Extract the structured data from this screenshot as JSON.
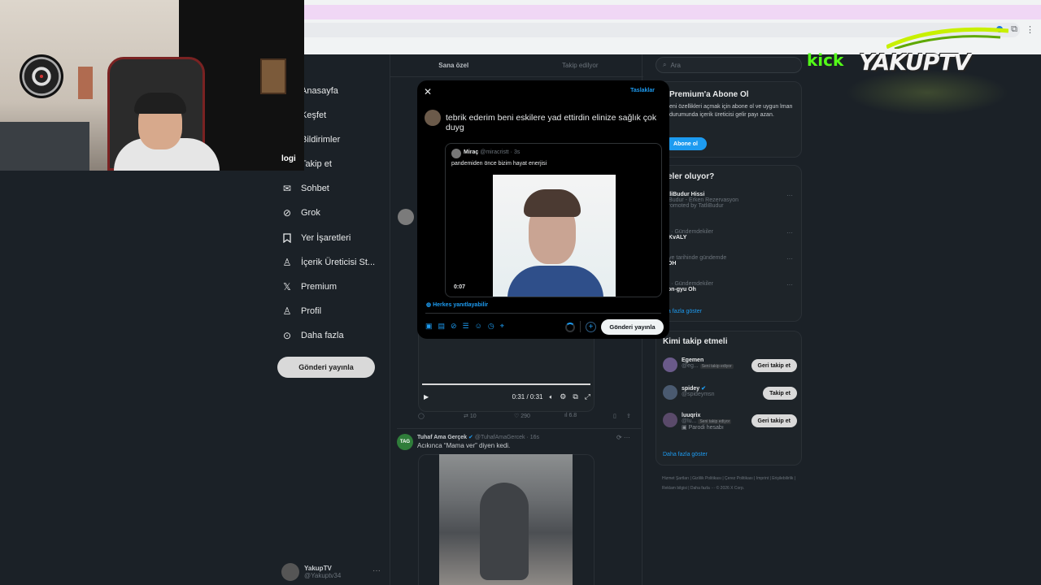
{
  "browser": {
    "title": ""
  },
  "webcam": {
    "brand_label": "logi"
  },
  "sidebar": {
    "items": [
      {
        "label": "Anasayfa",
        "icon": "home-icon"
      },
      {
        "label": "Keşfet",
        "icon": "search-icon"
      },
      {
        "label": "Bildirimler",
        "icon": "bell-icon"
      },
      {
        "label": "Takip et",
        "icon": "people-icon"
      },
      {
        "label": "Sohbet",
        "icon": "mail-icon"
      },
      {
        "label": "Grok",
        "icon": "grok-icon"
      },
      {
        "label": "Yer İşaretleri",
        "icon": "bookmark-icon"
      },
      {
        "label": "İçerik Üreticisi St...",
        "icon": "creator-icon"
      },
      {
        "label": "Premium",
        "icon": "x-logo-icon"
      },
      {
        "label": "Profil",
        "icon": "person-icon"
      },
      {
        "label": "Daha fazla",
        "icon": "more-circle-icon"
      }
    ],
    "post_button": "Gönderi yayınla",
    "account": {
      "name": "YakupTV",
      "handle": "@Yakuptv34"
    }
  },
  "timeline": {
    "tabs": [
      "Sana özel",
      "Takip edilyor"
    ],
    "video": {
      "time": "0:31 / 0:31"
    },
    "actions": {
      "retweets": "10",
      "likes": "290",
      "views": "6.8"
    },
    "tweet2": {
      "avatar_text": "TAG",
      "name": "Tuhaf Ama Gerçek",
      "handle": "@TuhafAmaGercek · 16s",
      "text": "Acıkınca “Mama ver” diyen kedi."
    }
  },
  "right": {
    "search_placeholder": "Ara",
    "premium": {
      "title": "Premium'a Abone Ol",
      "text": "eni özellikleri açmak için abone ol ve uygun lman durumunda içerik üreticisi gelir payı azan.",
      "button": "Abone ol"
    },
    "trends": {
      "title": "eler oluyor?",
      "items": [
        {
          "title": "atliBudur Hissi",
          "sub": "tliBudur - Erken Rezervasyon",
          "ctx": "Promoted by TatliBudur"
        },
        {
          "ctx": "or · Gündemdekiler",
          "title": "UKvALY"
        },
        {
          "ctx": "kiye tarihinde gündemde",
          "title": "i OH"
        },
        {
          "ctx": "or · Gündemdekiler",
          "title": "eon-gyu Oh"
        }
      ],
      "show_more": "ha fazla göster"
    },
    "who_to_follow": {
      "title": "Kimi takip etmeli",
      "users": [
        {
          "name": "Egemen",
          "handle": "@eg...",
          "badge": "Seni takip ediyor",
          "button": "Geri takip et",
          "extra": ""
        },
        {
          "name": "spidey",
          "handle": "@spideymsn",
          "badge": "",
          "button": "Takip et",
          "extra": ""
        },
        {
          "name": "luuqrix",
          "handle": "@lu...",
          "badge": "Seni takip ediyor",
          "button": "Geri takip et",
          "extra": "Parodi hesabı"
        }
      ],
      "show_more": "Daha fazla göster"
    },
    "footer": "Hizmet Şartları | Gizlilik Politikası | Çerez Politikası | Imprint | Erişilebilirlik | Reklam bilgisi | Daha fazla ··· © 2026 X Corp."
  },
  "overlay": {
    "kick": "kick",
    "brand": "YAKUPTV"
  },
  "modal": {
    "drafts": "Taslaklar",
    "composer_text": "tebrik ederim beni eskilere yad ettirdin elinize sağlık çok duyg",
    "quote": {
      "name": "Miraç",
      "handle": "@miracristt · 3s",
      "text": "pandemiden önce bizim hayat enerjisi",
      "video_time": "0:07"
    },
    "reply_setting": "Herkes yanıtlayabilir",
    "submit": "Gönderi yayınla"
  }
}
